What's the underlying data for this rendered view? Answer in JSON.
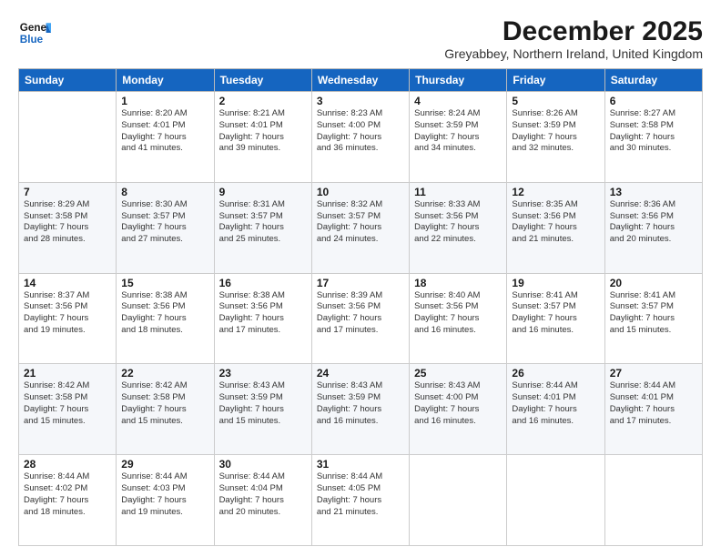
{
  "header": {
    "logo_line1": "General",
    "logo_line2": "Blue",
    "month": "December 2025",
    "location": "Greyabbey, Northern Ireland, United Kingdom"
  },
  "columns": [
    "Sunday",
    "Monday",
    "Tuesday",
    "Wednesday",
    "Thursday",
    "Friday",
    "Saturday"
  ],
  "weeks": [
    [
      {
        "day": "",
        "info": ""
      },
      {
        "day": "1",
        "info": "Sunrise: 8:20 AM\nSunset: 4:01 PM\nDaylight: 7 hours\nand 41 minutes."
      },
      {
        "day": "2",
        "info": "Sunrise: 8:21 AM\nSunset: 4:01 PM\nDaylight: 7 hours\nand 39 minutes."
      },
      {
        "day": "3",
        "info": "Sunrise: 8:23 AM\nSunset: 4:00 PM\nDaylight: 7 hours\nand 36 minutes."
      },
      {
        "day": "4",
        "info": "Sunrise: 8:24 AM\nSunset: 3:59 PM\nDaylight: 7 hours\nand 34 minutes."
      },
      {
        "day": "5",
        "info": "Sunrise: 8:26 AM\nSunset: 3:59 PM\nDaylight: 7 hours\nand 32 minutes."
      },
      {
        "day": "6",
        "info": "Sunrise: 8:27 AM\nSunset: 3:58 PM\nDaylight: 7 hours\nand 30 minutes."
      }
    ],
    [
      {
        "day": "7",
        "info": "Sunrise: 8:29 AM\nSunset: 3:58 PM\nDaylight: 7 hours\nand 28 minutes."
      },
      {
        "day": "8",
        "info": "Sunrise: 8:30 AM\nSunset: 3:57 PM\nDaylight: 7 hours\nand 27 minutes."
      },
      {
        "day": "9",
        "info": "Sunrise: 8:31 AM\nSunset: 3:57 PM\nDaylight: 7 hours\nand 25 minutes."
      },
      {
        "day": "10",
        "info": "Sunrise: 8:32 AM\nSunset: 3:57 PM\nDaylight: 7 hours\nand 24 minutes."
      },
      {
        "day": "11",
        "info": "Sunrise: 8:33 AM\nSunset: 3:56 PM\nDaylight: 7 hours\nand 22 minutes."
      },
      {
        "day": "12",
        "info": "Sunrise: 8:35 AM\nSunset: 3:56 PM\nDaylight: 7 hours\nand 21 minutes."
      },
      {
        "day": "13",
        "info": "Sunrise: 8:36 AM\nSunset: 3:56 PM\nDaylight: 7 hours\nand 20 minutes."
      }
    ],
    [
      {
        "day": "14",
        "info": "Sunrise: 8:37 AM\nSunset: 3:56 PM\nDaylight: 7 hours\nand 19 minutes."
      },
      {
        "day": "15",
        "info": "Sunrise: 8:38 AM\nSunset: 3:56 PM\nDaylight: 7 hours\nand 18 minutes."
      },
      {
        "day": "16",
        "info": "Sunrise: 8:38 AM\nSunset: 3:56 PM\nDaylight: 7 hours\nand 17 minutes."
      },
      {
        "day": "17",
        "info": "Sunrise: 8:39 AM\nSunset: 3:56 PM\nDaylight: 7 hours\nand 17 minutes."
      },
      {
        "day": "18",
        "info": "Sunrise: 8:40 AM\nSunset: 3:56 PM\nDaylight: 7 hours\nand 16 minutes."
      },
      {
        "day": "19",
        "info": "Sunrise: 8:41 AM\nSunset: 3:57 PM\nDaylight: 7 hours\nand 16 minutes."
      },
      {
        "day": "20",
        "info": "Sunrise: 8:41 AM\nSunset: 3:57 PM\nDaylight: 7 hours\nand 15 minutes."
      }
    ],
    [
      {
        "day": "21",
        "info": "Sunrise: 8:42 AM\nSunset: 3:58 PM\nDaylight: 7 hours\nand 15 minutes."
      },
      {
        "day": "22",
        "info": "Sunrise: 8:42 AM\nSunset: 3:58 PM\nDaylight: 7 hours\nand 15 minutes."
      },
      {
        "day": "23",
        "info": "Sunrise: 8:43 AM\nSunset: 3:59 PM\nDaylight: 7 hours\nand 15 minutes."
      },
      {
        "day": "24",
        "info": "Sunrise: 8:43 AM\nSunset: 3:59 PM\nDaylight: 7 hours\nand 16 minutes."
      },
      {
        "day": "25",
        "info": "Sunrise: 8:43 AM\nSunset: 4:00 PM\nDaylight: 7 hours\nand 16 minutes."
      },
      {
        "day": "26",
        "info": "Sunrise: 8:44 AM\nSunset: 4:01 PM\nDaylight: 7 hours\nand 16 minutes."
      },
      {
        "day": "27",
        "info": "Sunrise: 8:44 AM\nSunset: 4:01 PM\nDaylight: 7 hours\nand 17 minutes."
      }
    ],
    [
      {
        "day": "28",
        "info": "Sunrise: 8:44 AM\nSunset: 4:02 PM\nDaylight: 7 hours\nand 18 minutes."
      },
      {
        "day": "29",
        "info": "Sunrise: 8:44 AM\nSunset: 4:03 PM\nDaylight: 7 hours\nand 19 minutes."
      },
      {
        "day": "30",
        "info": "Sunrise: 8:44 AM\nSunset: 4:04 PM\nDaylight: 7 hours\nand 20 minutes."
      },
      {
        "day": "31",
        "info": "Sunrise: 8:44 AM\nSunset: 4:05 PM\nDaylight: 7 hours\nand 21 minutes."
      },
      {
        "day": "",
        "info": ""
      },
      {
        "day": "",
        "info": ""
      },
      {
        "day": "",
        "info": ""
      }
    ]
  ]
}
